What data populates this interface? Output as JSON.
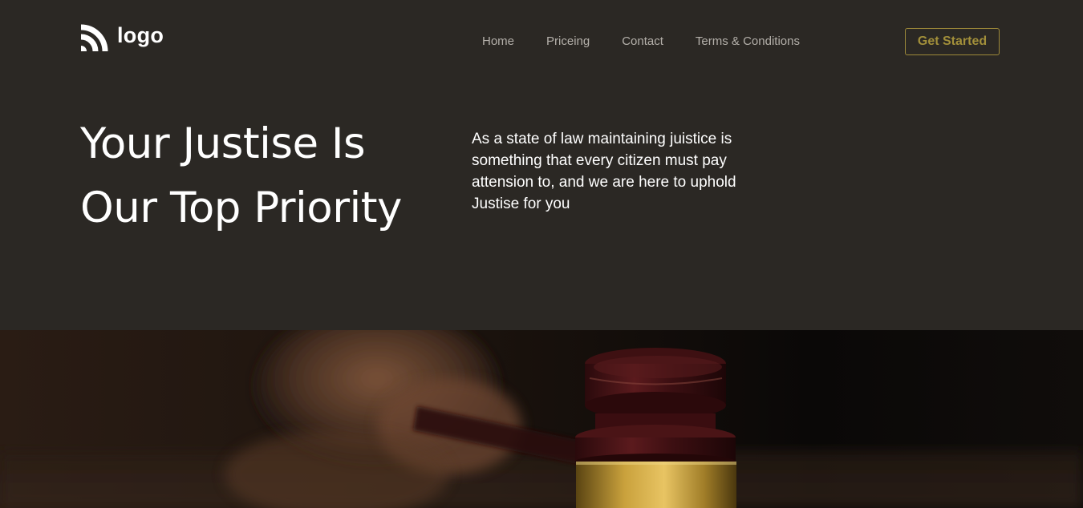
{
  "header": {
    "logo_text": "logo",
    "nav": {
      "home": "Home",
      "pricing": "Priceing",
      "contact": "Contact",
      "terms": "Terms & Conditions"
    },
    "cta_label": "Get Started"
  },
  "hero": {
    "title_line1": "Your Justise Is",
    "title_line2": "Our Top Priority",
    "description": "As a state of law maintaining juistice is something that every citizen must pay attension to, and we are here to uphold Justise for you"
  },
  "colors": {
    "background": "#2b2824",
    "accent": "#a28f3a",
    "nav_text": "#b4b0aa",
    "heading_text": "#ffffff"
  },
  "icons": {
    "logo": "signal-waves-icon"
  }
}
